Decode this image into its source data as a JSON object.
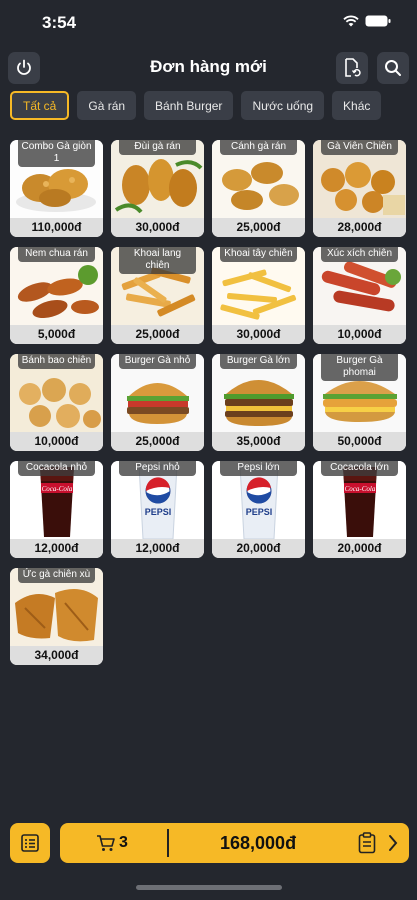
{
  "status": {
    "time": "3:54"
  },
  "header": {
    "title": "Đơn hàng mới"
  },
  "categories": [
    "Tất cả",
    "Gà rán",
    "Bánh Burger",
    "Nước uống",
    "Khác"
  ],
  "items": [
    {
      "name": "Combo Gà giòn 1",
      "price": "110,000đ",
      "img": "fried-chicken"
    },
    {
      "name": "Đùi gà rán",
      "price": "30,000đ",
      "img": "drumsticks"
    },
    {
      "name": "Cánh gà rán",
      "price": "25,000đ",
      "img": "wings"
    },
    {
      "name": "Gà Viên Chiên",
      "price": "28,000đ",
      "img": "chicken-balls"
    },
    {
      "name": "Nem chua rán",
      "price": "5,000đ",
      "img": "fried-rolls"
    },
    {
      "name": "Khoai lang chiên",
      "price": "25,000đ",
      "img": "sweet-potato-fries"
    },
    {
      "name": "Khoai tây chiên",
      "price": "30,000đ",
      "img": "french-fries"
    },
    {
      "name": "Xúc xích chiên",
      "price": "10,000đ",
      "img": "sausages"
    },
    {
      "name": "Bánh bao chiên",
      "price": "10,000đ",
      "img": "fried-buns"
    },
    {
      "name": "Burger Gà nhỏ",
      "price": "25,000đ",
      "img": "burger-small"
    },
    {
      "name": "Burger Gà lớn",
      "price": "35,000đ",
      "img": "burger-large"
    },
    {
      "name": "Burger Gà phomai",
      "price": "50,000đ",
      "img": "burger-cheese"
    },
    {
      "name": "Cocacola nhỏ",
      "price": "12,000đ",
      "img": "coca-cola"
    },
    {
      "name": "Pepsi nhỏ",
      "price": "12,000đ",
      "img": "pepsi"
    },
    {
      "name": "Pepsi lớn",
      "price": "20,000đ",
      "img": "pepsi"
    },
    {
      "name": "Cocacola lớn",
      "price": "20,000đ",
      "img": "coca-cola"
    },
    {
      "name": "Ức gà chiên xù",
      "price": "34,000đ",
      "img": "chicken-breast"
    }
  ],
  "cart": {
    "count": "3",
    "total": "168,000đ"
  },
  "colors": {
    "accent": "#f6b926",
    "background": "#24272e",
    "button": "#3a3e47"
  }
}
